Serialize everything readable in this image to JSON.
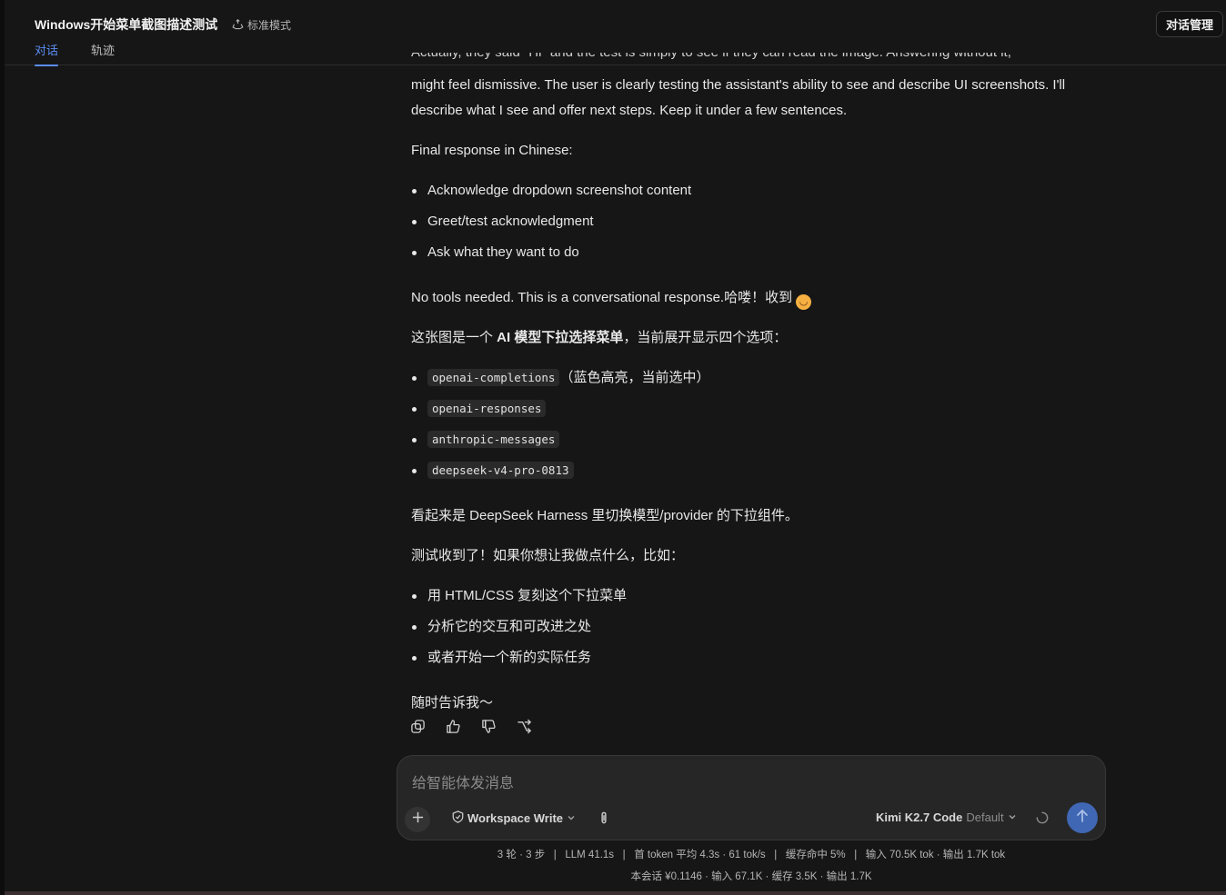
{
  "header": {
    "title": "Windows开始菜单截图描述测试",
    "mode_label": "标准模式",
    "tabs": [
      {
        "label": "对话",
        "active": true
      },
      {
        "label": "轨迹",
        "active": false
      }
    ],
    "manage_button": "对话管理"
  },
  "message": {
    "cut_line": "Actually, they said \"Hi\" and the test is simply to see if they can read the image. Answering without it,",
    "para1": "might feel dismissive. The user is clearly testing the assistant's ability to see and describe UI screenshots. I'll describe what I see and offer next steps. Keep it under a few sentences.",
    "para2": "Final response in Chinese:",
    "plan_items": [
      "Acknowledge dropdown screenshot content",
      "Greet/test acknowledgment",
      "Ask what they want to do"
    ],
    "para3": "No tools needed. This is a conversational response.哈喽！收到",
    "emoji": "😄",
    "intro_prefix": "这张图是一个 ",
    "intro_bold": "AI 模型下拉选择菜单",
    "intro_suffix": "，当前展开显示四个选项：",
    "options": [
      {
        "code": "openai-completions",
        "note": "（蓝色高亮，当前选中）"
      },
      {
        "code": "openai-responses",
        "note": ""
      },
      {
        "code": "anthropic-messages",
        "note": ""
      },
      {
        "code": "deepseek-v4-pro-0813",
        "note": ""
      }
    ],
    "para4": "看起来是 DeepSeek Harness 里切换模型/provider 的下拉组件。",
    "para5": "测试收到了！如果你想让我做点什么，比如：",
    "suggestions": [
      "用 HTML/CSS 复刻这个下拉菜单",
      "分析它的交互和可改进之处",
      "或者开始一个新的实际任务"
    ],
    "para6": "随时告诉我～"
  },
  "actions": {
    "icons": [
      "copy-icon",
      "thumbs-up-icon",
      "thumbs-down-icon",
      "branch-icon"
    ]
  },
  "composer": {
    "placeholder": "给智能体发消息",
    "workspace_label": "Workspace Write",
    "model_name": "Kimi K2.7 Code",
    "model_variant": "Default",
    "accent": "#3f67b3"
  },
  "stats": {
    "line1": "3 轮 · 3 步   |   LLM 41.1s   |   首 token 平均 4.3s · 61 tok/s   |   缓存命中 5%   |   输入 70.5K tok · 输出 1.7K tok",
    "line2": "本会话 ¥0.1146 · 输入 67.1K · 缓存 3.5K · 输出 1.7K"
  }
}
